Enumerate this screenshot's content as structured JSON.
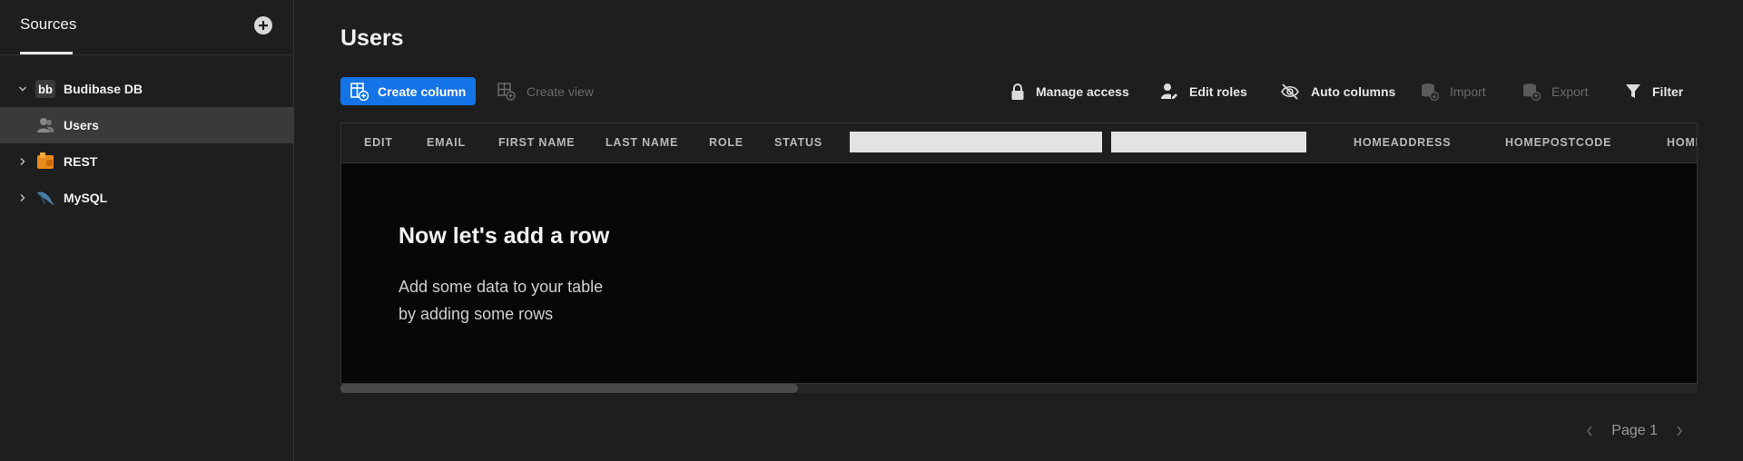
{
  "sidebar": {
    "title": "Sources",
    "add_icon": "plus-circle-icon",
    "items": [
      {
        "label": "Budibase DB",
        "icon": "budibase-logo-icon",
        "expanded": true
      },
      {
        "label": "Users",
        "icon": "user-group-icon",
        "selected": true
      },
      {
        "label": "REST",
        "icon": "rest-api-icon",
        "expanded": false
      },
      {
        "label": "MySQL",
        "icon": "mysql-dolphin-icon",
        "expanded": false
      }
    ]
  },
  "main": {
    "title": "Users",
    "toolbar": {
      "create_column": "Create column",
      "create_view": "Create view",
      "manage_access": "Manage access",
      "edit_roles": "Edit roles",
      "auto_columns": "Auto columns",
      "import": "Import",
      "export": "Export",
      "filter": "Filter"
    },
    "table": {
      "columns": [
        "EDIT",
        "EMAIL",
        "FIRST NAME",
        "LAST NAME",
        "ROLE",
        "STATUS",
        "",
        "",
        "HOMEADDRESS",
        "HOMEPOSTCODE",
        "HOMI"
      ]
    },
    "empty": {
      "title": "Now let's add a row",
      "line1": "Add some data to your table",
      "line2": "by adding some rows"
    },
    "pager": {
      "label": "Page 1"
    }
  },
  "colors": {
    "accent": "#1473e6",
    "background": "#1e1e1e",
    "table_body": "#070707"
  }
}
